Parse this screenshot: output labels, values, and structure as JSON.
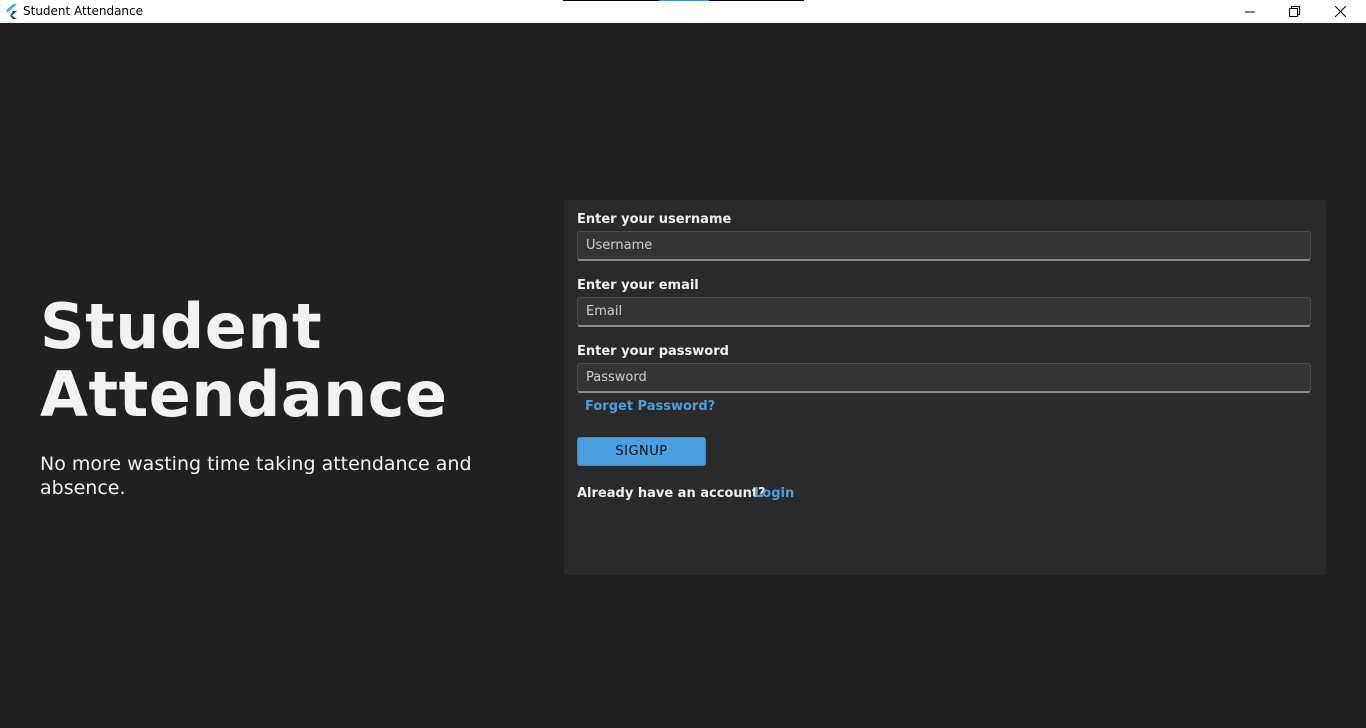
{
  "window": {
    "title": "Student Attendance",
    "icon": "flutter-logo-icon",
    "controls": [
      "minimize-icon",
      "maximize-icon",
      "close-icon"
    ]
  },
  "hero": {
    "title_line1": "Student",
    "title_line2": "Attendance",
    "subtitle": "No more wasting time taking attendance and absence."
  },
  "form": {
    "username_label": "Enter your username",
    "username_placeholder": "Username",
    "username_value": "",
    "email_label": "Enter your email",
    "email_placeholder": "Email",
    "email_value": "",
    "password_label": "Enter your password",
    "password_placeholder": "Password",
    "password_value": "",
    "forget_password": "Forget Password?",
    "signup_label": "SIGNUP",
    "account_prompt": "Already have an account?",
    "login_link": "Login"
  },
  "colors": {
    "background": "#202020",
    "card": "#2a2a2a",
    "accent": "#4a9fe0",
    "text": "#f2f2f2"
  }
}
